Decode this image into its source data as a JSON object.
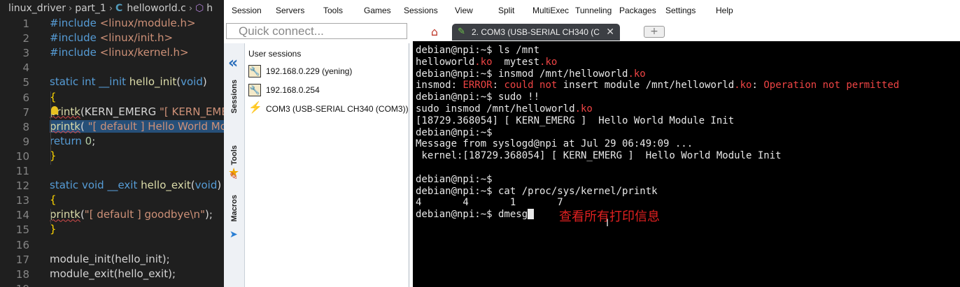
{
  "editor": {
    "breadcrumb": [
      "linux_driver",
      "part_1",
      "helloworld.c",
      "h"
    ],
    "lines": [
      {
        "n": "1",
        "tokens": [
          [
            "pp",
            "#include "
          ],
          [
            "inc",
            "<linux/module.h>"
          ]
        ]
      },
      {
        "n": "2",
        "tokens": [
          [
            "pp",
            "#include "
          ],
          [
            "inc",
            "<linux/init.h>"
          ]
        ]
      },
      {
        "n": "3",
        "tokens": [
          [
            "pp",
            "#include "
          ],
          [
            "inc",
            "<linux/kernel.h>"
          ]
        ]
      },
      {
        "n": "4",
        "tokens": []
      },
      {
        "n": "5",
        "tokens": [
          [
            "kw",
            "static int __init "
          ],
          [
            "fn",
            "hello_init"
          ],
          [
            "",
            "("
          ],
          [
            "kw",
            "void"
          ],
          [
            "",
            ")"
          ]
        ]
      },
      {
        "n": "6",
        "tokens": [
          [
            "br",
            "{"
          ]
        ]
      },
      {
        "n": "7",
        "tokens": [
          [
            "fn squig",
            "printk"
          ],
          [
            "",
            "(KERN_EMERG "
          ],
          [
            "st",
            "\"[ KERN_EME"
          ]
        ]
      },
      {
        "n": "8",
        "tokens": [
          [
            "fn squig sel",
            "printk"
          ],
          [
            "sel",
            "( "
          ],
          [
            "st sel",
            "\"[ default ]  Hello World Mod"
          ]
        ]
      },
      {
        "n": "9",
        "tokens": [
          [
            "kw",
            "return "
          ],
          [
            "num",
            "0"
          ],
          [
            "",
            ";"
          ]
        ]
      },
      {
        "n": "10",
        "tokens": [
          [
            "br",
            "}"
          ]
        ]
      },
      {
        "n": "11",
        "tokens": []
      },
      {
        "n": "12",
        "tokens": [
          [
            "kw",
            "static void __exit "
          ],
          [
            "fn",
            "hello_exit"
          ],
          [
            "",
            "("
          ],
          [
            "kw",
            "void"
          ],
          [
            "",
            ")"
          ]
        ]
      },
      {
        "n": "13",
        "tokens": [
          [
            "br",
            "{"
          ]
        ]
      },
      {
        "n": "14",
        "tokens": [
          [
            "fn squig",
            " printk"
          ],
          [
            "",
            "("
          ],
          [
            "st",
            "\"[ default ]   goodbye\\n\""
          ],
          [
            "",
            ");"
          ]
        ]
      },
      {
        "n": "15",
        "tokens": [
          [
            "br",
            "}"
          ]
        ]
      },
      {
        "n": "16",
        "tokens": []
      },
      {
        "n": "17",
        "tokens": [
          [
            "",
            "module_init"
          ],
          [
            "",
            "("
          ],
          [
            "",
            "hello_init"
          ],
          [
            "",
            ");"
          ]
        ]
      },
      {
        "n": "18",
        "tokens": [
          [
            "",
            "module_exit"
          ],
          [
            "",
            "("
          ],
          [
            "",
            "hello_exit"
          ],
          [
            "",
            ");"
          ]
        ]
      },
      {
        "n": "19",
        "tokens": []
      }
    ]
  },
  "menubar": [
    "Session",
    "Servers",
    "Tools",
    "Games",
    "Sessions",
    "View",
    "Split",
    "MultiExec",
    "Tunneling",
    "Packages",
    "Settings",
    "Help"
  ],
  "quick_connect": {
    "placeholder": "Quick connect..."
  },
  "sidebar_tabs": {
    "sessions": "Sessions",
    "tools": "Tools",
    "macros": "Macros"
  },
  "sessions": {
    "title": "User sessions",
    "items": [
      {
        "label": "192.168.0.229 (yening)",
        "icon": "ssh-key-icon"
      },
      {
        "label": "192.168.0.254",
        "icon": "ssh-key-icon"
      },
      {
        "label": "COM3  (USB-SERIAL CH340 (COM3))",
        "icon": "serial-plug-icon"
      }
    ]
  },
  "terminal_tab": {
    "label": "2. COM3  (USB-SERIAL CH340 (C"
  },
  "terminal": {
    "lines": [
      [
        [
          "",
          "debian@npi:~$ ls /mnt"
        ]
      ],
      [
        [
          "",
          "helloworld"
        ],
        [
          "red",
          ".ko"
        ],
        [
          "",
          "  mytest"
        ],
        [
          "red",
          ".ko"
        ]
      ],
      [
        [
          "",
          "debian@npi:~$ insmod /mnt/helloworld"
        ],
        [
          "red",
          ".ko"
        ]
      ],
      [
        [
          "",
          "insmod: "
        ],
        [
          "red",
          "ERROR"
        ],
        [
          "",
          ": "
        ],
        [
          "red",
          "could not"
        ],
        [
          "",
          " insert module /mnt/helloworld"
        ],
        [
          "red",
          ".ko"
        ],
        [
          "",
          ": "
        ],
        [
          "red",
          "Operation not permitted"
        ]
      ],
      [
        [
          "",
          "debian@npi:~$ sudo !!"
        ]
      ],
      [
        [
          "",
          "sudo insmod /mnt/helloworld"
        ],
        [
          "red",
          ".ko"
        ]
      ],
      [
        [
          "",
          "[18729.368054] [ KERN_EMERG ]  Hello World Module Init"
        ]
      ],
      [
        [
          "",
          "debian@npi:~$"
        ]
      ],
      [
        [
          "",
          "Message from syslogd@npi at Jul 29 06:49:09 ..."
        ]
      ],
      [
        [
          "",
          " kernel:[18729.368054] [ KERN_EMERG ]  Hello World Module Init"
        ]
      ],
      [
        [
          "",
          ""
        ]
      ],
      [
        [
          "",
          "debian@npi:~$"
        ]
      ],
      [
        [
          "",
          "debian@npi:~$ cat /proc/sys/kernel/printk"
        ]
      ],
      [
        [
          "",
          "4       4       1       7"
        ]
      ],
      [
        [
          "",
          "debian@npi:~$ dmesg"
        ]
      ]
    ],
    "annotation": "查看所有打印信息"
  }
}
